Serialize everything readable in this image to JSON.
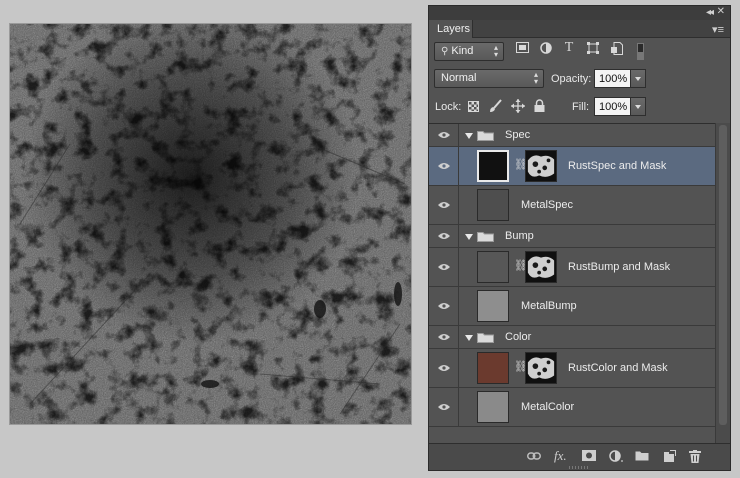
{
  "panel": {
    "tab_label": "Layers",
    "filter": {
      "kind_label": "Kind",
      "icons": [
        "image-filter-icon",
        "adjustment-filter-icon",
        "type-filter-icon",
        "shape-filter-icon",
        "smart-object-filter-icon"
      ]
    },
    "blend_mode": "Normal",
    "opacity_label": "Opacity:",
    "opacity_value": "100%",
    "lock_label": "Lock:",
    "fill_label": "Fill:",
    "fill_value": "100%"
  },
  "layers": [
    {
      "type": "group",
      "name": "Spec"
    },
    {
      "type": "layer",
      "name": "RustSpec and Mask",
      "thumb": "#111111",
      "has_mask": true,
      "selected": true
    },
    {
      "type": "layer",
      "name": "MetalSpec",
      "thumb": "#4e4e4e",
      "has_mask": false
    },
    {
      "type": "group",
      "name": "Bump"
    },
    {
      "type": "layer",
      "name": "RustBump and Mask",
      "thumb": "#575757",
      "has_mask": true
    },
    {
      "type": "layer",
      "name": "MetalBump",
      "thumb": "#8e8e8e",
      "has_mask": false
    },
    {
      "type": "group",
      "name": "Color"
    },
    {
      "type": "layer",
      "name": "RustColor and Mask",
      "thumb": "#6b3a2e",
      "has_mask": true
    },
    {
      "type": "layer",
      "name": "MetalColor",
      "thumb": "#8a8a8a",
      "has_mask": false
    }
  ],
  "bottom_icons": [
    "link-layers-icon",
    "fx-icon",
    "add-mask-icon",
    "adjustment-layer-icon",
    "new-group-icon",
    "new-layer-icon",
    "trash-icon"
  ]
}
